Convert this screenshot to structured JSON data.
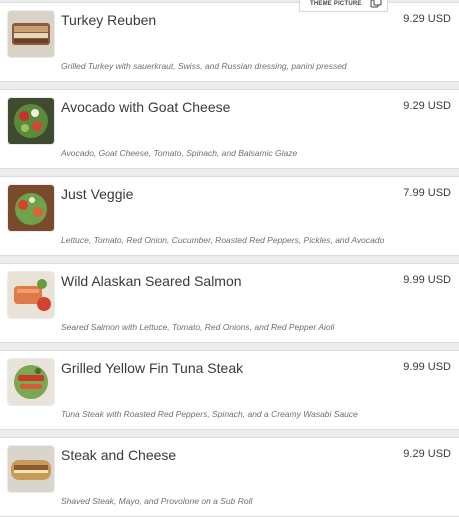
{
  "theme_button": {
    "label": "THEME PICTURE",
    "icon": "copy-image-icon"
  },
  "menu": {
    "items": [
      {
        "name": "Turkey Reuben",
        "price": "9.29 USD",
        "description": "Grilled Turkey with sauerkraut, Swiss, and Russian dressing, panini pressed",
        "image_icon": "turkey-reuben-photo"
      },
      {
        "name": "Avocado with Goat Cheese",
        "price": "9.29 USD",
        "description": "Avocado, Goat Cheese, Tomato, Spinach, and Balsamic Glaze",
        "image_icon": "avocado-goat-cheese-photo"
      },
      {
        "name": "Just Veggie",
        "price": "7.99 USD",
        "description": "Lettuce, Tomato, Red Onion, Cucumber, Roasted Red Peppers, Pickles, and Avocado",
        "image_icon": "just-veggie-photo"
      },
      {
        "name": "Wild Alaskan Seared Salmon",
        "price": "9.99 USD",
        "description": "Seared Salmon with Lettuce, Tomato, Red Onions, and Red Pepper Aioli",
        "image_icon": "salmon-photo"
      },
      {
        "name": "Grilled Yellow Fin Tuna Steak",
        "price": "9.99 USD",
        "description": "Tuna Steak with Roasted Red Peppers, Spinach, and a Creamy Wasabi Sauce",
        "image_icon": "tuna-steak-photo"
      },
      {
        "name": "Steak and Cheese",
        "price": "9.29 USD",
        "description": "Shaved Steak, Mayo, and Provolone on a Sub Roll",
        "image_icon": "steak-cheese-photo"
      }
    ]
  }
}
